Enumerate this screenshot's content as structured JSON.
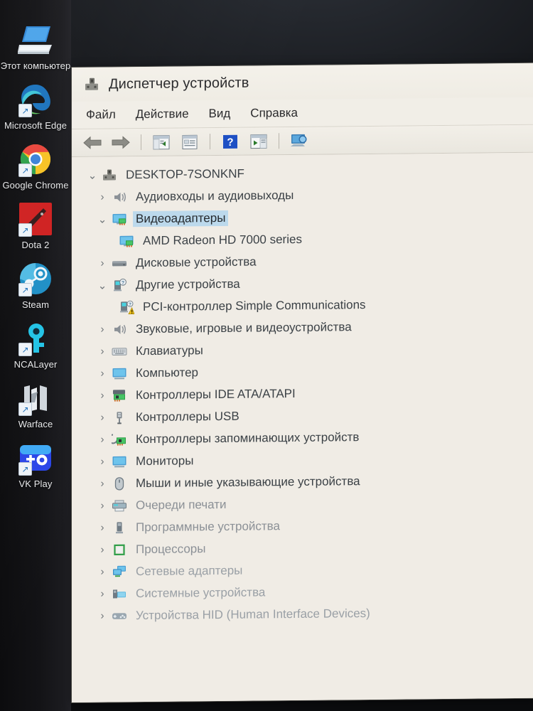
{
  "desktop": {
    "icons": [
      {
        "label": "Этот\nкомпьютер",
        "icon": "this-pc-icon",
        "shortcut": false
      },
      {
        "label": "Microsoft\nEdge",
        "icon": "microsoft-edge-icon",
        "shortcut": true
      },
      {
        "label": "Google\nChrome",
        "icon": "google-chrome-icon",
        "shortcut": true
      },
      {
        "label": "Dota 2",
        "icon": "dota2-icon",
        "shortcut": true
      },
      {
        "label": "Steam",
        "icon": "steam-icon",
        "shortcut": true
      },
      {
        "label": "NCALayer",
        "icon": "ncalayer-icon",
        "shortcut": true
      },
      {
        "label": "Warface",
        "icon": "warface-icon",
        "shortcut": true
      },
      {
        "label": "VK Play",
        "icon": "vk-play-icon",
        "shortcut": true
      }
    ]
  },
  "window": {
    "title": "Диспетчер устройств",
    "title_icon": "device-manager-icon",
    "menu": [
      {
        "label": "Файл",
        "name": "menu-file"
      },
      {
        "label": "Действие",
        "name": "menu-action"
      },
      {
        "label": "Вид",
        "name": "menu-view"
      },
      {
        "label": "Справка",
        "name": "menu-help"
      }
    ],
    "toolbar": [
      {
        "name": "back-button",
        "icon": "arrow-left-icon"
      },
      {
        "name": "forward-button",
        "icon": "arrow-right-icon"
      },
      {
        "name": "separator-1",
        "icon": "separator"
      },
      {
        "name": "show-hide-console-tree-button",
        "icon": "console-tree-icon"
      },
      {
        "name": "properties-button",
        "icon": "properties-icon"
      },
      {
        "name": "separator-2",
        "icon": "separator"
      },
      {
        "name": "help-button",
        "icon": "question-mark-icon"
      },
      {
        "name": "scan-hardware-changes-button",
        "icon": "scan-hardware-icon"
      },
      {
        "name": "separator-3",
        "icon": "separator"
      },
      {
        "name": "update-driver-button",
        "icon": "monitor-driver-icon"
      }
    ]
  },
  "tree": {
    "nodes": [
      {
        "label": "DESKTOP-7SONKNF",
        "depth": 0,
        "twisty": "expanded",
        "icon": "computer-node-icon",
        "selected": false,
        "shade": "dark"
      },
      {
        "label": "Аудиовходы и аудиовыходы",
        "depth": 1,
        "twisty": "collapsed",
        "icon": "speaker-icon",
        "selected": false,
        "shade": "dark"
      },
      {
        "label": "Видеоадаптеры",
        "depth": 1,
        "twisty": "expanded",
        "icon": "display-adapter-icon",
        "selected": true,
        "shade": "dark"
      },
      {
        "label": "AMD Radeon HD 7000 series",
        "depth": 2,
        "twisty": "none",
        "icon": "display-adapter-icon",
        "selected": false,
        "shade": "dark"
      },
      {
        "label": "Дисковые устройства",
        "depth": 1,
        "twisty": "collapsed",
        "icon": "disk-drive-icon",
        "selected": false,
        "shade": "dark"
      },
      {
        "label": "Другие устройства",
        "depth": 1,
        "twisty": "expanded",
        "icon": "unknown-device-icon",
        "selected": false,
        "shade": "dark"
      },
      {
        "label": "PCI-контроллер Simple Communications",
        "depth": 2,
        "twisty": "none",
        "icon": "unknown-device-warning-icon",
        "selected": false,
        "shade": "dark"
      },
      {
        "label": "Звуковые, игровые и видеоустройства",
        "depth": 1,
        "twisty": "collapsed",
        "icon": "speaker-icon",
        "selected": false,
        "shade": "dark"
      },
      {
        "label": "Клавиатуры",
        "depth": 1,
        "twisty": "collapsed",
        "icon": "keyboard-icon",
        "selected": false,
        "shade": "dark"
      },
      {
        "label": "Компьютер",
        "depth": 1,
        "twisty": "collapsed",
        "icon": "monitor-icon",
        "selected": false,
        "shade": "dark"
      },
      {
        "label": "Контроллеры IDE ATA/ATAPI",
        "depth": 1,
        "twisty": "collapsed",
        "icon": "ide-controller-icon",
        "selected": false,
        "shade": "dark"
      },
      {
        "label": "Контроллеры USB",
        "depth": 1,
        "twisty": "collapsed",
        "icon": "usb-icon",
        "selected": false,
        "shade": "dark"
      },
      {
        "label": "Контроллеры запоминающих устройств",
        "depth": 1,
        "twisty": "collapsed",
        "icon": "storage-controller-icon",
        "selected": false,
        "shade": "dark"
      },
      {
        "label": "Мониторы",
        "depth": 1,
        "twisty": "collapsed",
        "icon": "monitor-icon",
        "selected": false,
        "shade": "dark"
      },
      {
        "label": "Мыши и иные указывающие устройства",
        "depth": 1,
        "twisty": "collapsed",
        "icon": "mouse-icon",
        "selected": false,
        "shade": "dark"
      },
      {
        "label": "Очереди печати",
        "depth": 1,
        "twisty": "collapsed",
        "icon": "printer-icon",
        "selected": false,
        "shade": "mid"
      },
      {
        "label": "Программные устройства",
        "depth": 1,
        "twisty": "collapsed",
        "icon": "software-device-icon",
        "selected": false,
        "shade": "mid"
      },
      {
        "label": "Процессоры",
        "depth": 1,
        "twisty": "collapsed",
        "icon": "processor-icon",
        "selected": false,
        "shade": "mid"
      },
      {
        "label": "Сетевые адаптеры",
        "depth": 1,
        "twisty": "collapsed",
        "icon": "network-adapter-icon",
        "selected": false,
        "shade": "light"
      },
      {
        "label": "Системные устройства",
        "depth": 1,
        "twisty": "collapsed",
        "icon": "system-device-icon",
        "selected": false,
        "shade": "light"
      },
      {
        "label": "Устройства HID (Human Interface Devices)",
        "depth": 1,
        "twisty": "collapsed",
        "icon": "hid-device-icon",
        "selected": false,
        "shade": "light"
      }
    ]
  },
  "colors": {
    "selection": "#bcd9ec",
    "window_bg": "#f0ece5",
    "text": "#3b4146",
    "warning": "#f0c419"
  }
}
